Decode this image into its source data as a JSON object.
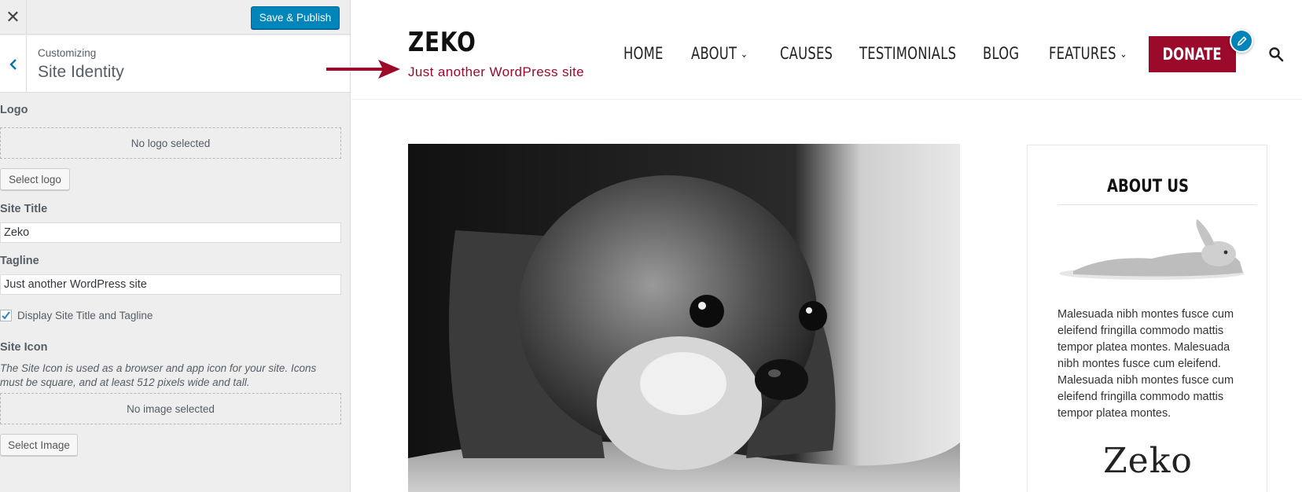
{
  "customizer": {
    "close_glyph": "✕",
    "publish_label": "Save & Publish",
    "breadcrumb": "Customizing",
    "section_title": "Site Identity",
    "logo": {
      "label": "Logo",
      "placeholder": "No logo selected",
      "button": "Select logo"
    },
    "site_title": {
      "label": "Site Title",
      "value": "Zeko"
    },
    "tagline": {
      "label": "Tagline",
      "value": "Just another WordPress site"
    },
    "display_title_tagline": {
      "label": "Display Site Title and Tagline",
      "checked": true
    },
    "site_icon": {
      "label": "Site Icon",
      "description": "The Site Icon is used as a browser and app icon for your site. Icons must be square, and at least 512 pixels wide and tall.",
      "placeholder": "No image selected",
      "button": "Select Image"
    }
  },
  "preview": {
    "site_title": "ZEKO",
    "tagline": "Just another WordPress site",
    "nav": {
      "home": "HOME",
      "about": "ABOUT",
      "causes": "CAUSES",
      "testimonials": "TESTIMONIALS",
      "blog": "BLOG",
      "features": "FEATURES",
      "donate": "DONATE"
    },
    "widget": {
      "title": "ABOUT US",
      "text": "Malesuada nibh montes fusce cum eleifend fringilla commodo mattis tempor platea montes. Malesuada nibh montes fusce cum eleifend. Malesuada nibh montes fusce cum eleifend fringilla commodo mattis tempor platea montes.",
      "logo_text": "Zeko"
    }
  },
  "colors": {
    "accent": "#9b0a2a",
    "wp_blue": "#0085ba",
    "panel_bg": "#eeeeee"
  },
  "icons": [
    "close-icon",
    "back-chevron-icon",
    "checkmark-icon",
    "chevron-down-icon",
    "pencil-icon",
    "search-icon",
    "arrow-icon"
  ]
}
